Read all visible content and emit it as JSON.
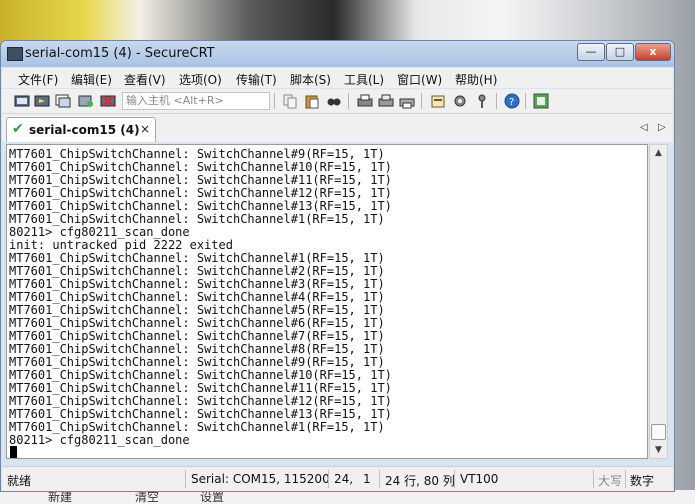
{
  "window": {
    "title": "serial-com15 (4) - SecureCRT",
    "controls": {
      "minimize": "—",
      "maximize": "□",
      "close": "x"
    }
  },
  "menu": [
    "文件(F)",
    "编辑(E)",
    "查看(V)",
    "选项(O)",
    "传输(T)",
    "脚本(S)",
    "工具(L)",
    "窗口(W)",
    "帮助(H)"
  ],
  "toolbar": {
    "host_placeholder": "输入主机 <Alt+R>",
    "icons": [
      "connect-icon",
      "quick-connect-icon",
      "connect-tab-icon",
      "reconnect-icon",
      "disconnect-icon",
      "copy-icon",
      "paste-icon",
      "find-icon",
      "print-setup-icon",
      "print-selection-icon",
      "print-icon",
      "session-options-icon",
      "global-options-icon",
      "keymap-icon",
      "help-icon",
      "sftp-icon"
    ]
  },
  "tab": {
    "label": "serial-com15 (4)",
    "close": "×",
    "nav_left": "◁",
    "nav_right": "▷"
  },
  "terminal": {
    "lines": [
      "MT7601_ChipSwitchChannel: SwitchChannel#9(RF=15, 1T)",
      "MT7601_ChipSwitchChannel: SwitchChannel#10(RF=15, 1T)",
      "MT7601_ChipSwitchChannel: SwitchChannel#11(RF=15, 1T)",
      "MT7601_ChipSwitchChannel: SwitchChannel#12(RF=15, 1T)",
      "MT7601_ChipSwitchChannel: SwitchChannel#13(RF=15, 1T)",
      "MT7601_ChipSwitchChannel: SwitchChannel#1(RF=15, 1T)",
      "80211> cfg80211_scan_done",
      "init: untracked pid 2222 exited",
      "MT7601_ChipSwitchChannel: SwitchChannel#1(RF=15, 1T)",
      "MT7601_ChipSwitchChannel: SwitchChannel#2(RF=15, 1T)",
      "MT7601_ChipSwitchChannel: SwitchChannel#3(RF=15, 1T)",
      "MT7601_ChipSwitchChannel: SwitchChannel#4(RF=15, 1T)",
      "MT7601_ChipSwitchChannel: SwitchChannel#5(RF=15, 1T)",
      "MT7601_ChipSwitchChannel: SwitchChannel#6(RF=15, 1T)",
      "MT7601_ChipSwitchChannel: SwitchChannel#7(RF=15, 1T)",
      "MT7601_ChipSwitchChannel: SwitchChannel#8(RF=15, 1T)",
      "MT7601_ChipSwitchChannel: SwitchChannel#9(RF=15, 1T)",
      "MT7601_ChipSwitchChannel: SwitchChannel#10(RF=15, 1T)",
      "MT7601_ChipSwitchChannel: SwitchChannel#11(RF=15, 1T)",
      "MT7601_ChipSwitchChannel: SwitchChannel#12(RF=15, 1T)",
      "MT7601_ChipSwitchChannel: SwitchChannel#13(RF=15, 1T)",
      "MT7601_ChipSwitchChannel: SwitchChannel#1(RF=15, 1T)",
      "80211> cfg80211_scan_done"
    ]
  },
  "statusbar": {
    "ready": "就绪",
    "connection": "Serial: COM15, 115200",
    "row": "24,",
    "col": "1",
    "size": "24 行, 80 列",
    "emulation": "VT100",
    "caps": "大写",
    "num": "数字"
  },
  "taskbar": {
    "new": "新建",
    "clear": "清空",
    "settings": "设置"
  },
  "colors": {
    "tab_check": "#2e9c3a",
    "close_button": "#c8412a",
    "title_gradient": "#a9c3e3"
  }
}
